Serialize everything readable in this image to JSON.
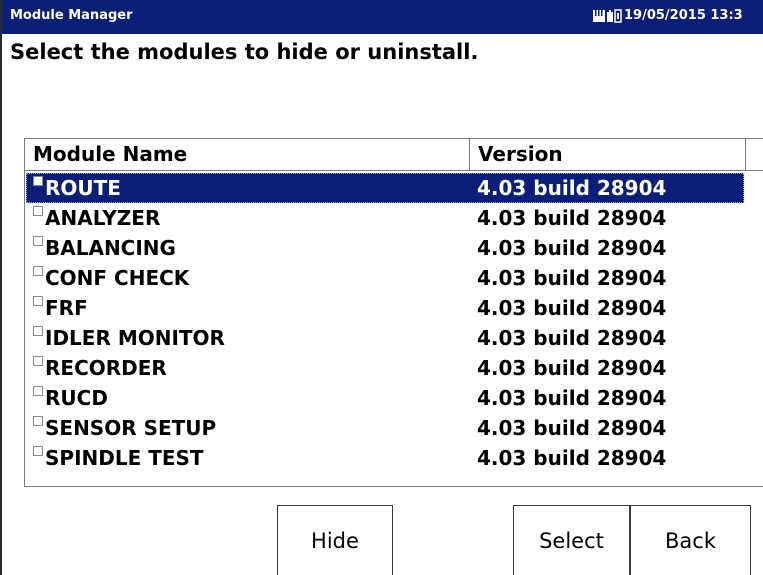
{
  "window": {
    "title": "Module Manager",
    "datetime": "19/05/2015 13:3",
    "status_icons": [
      "sd-card-icon",
      "battery-plug-icon"
    ]
  },
  "instruction": "Select the modules to hide or uninstall.",
  "table": {
    "columns": [
      "Module Name",
      "Version"
    ],
    "selected_index": 0,
    "rows": [
      {
        "name": "ROUTE",
        "version": "4.03 build 28904",
        "checked": false
      },
      {
        "name": "ANALYZER",
        "version": "4.03 build 28904",
        "checked": false
      },
      {
        "name": "BALANCING",
        "version": "4.03 build 28904",
        "checked": false
      },
      {
        "name": "CONF CHECK",
        "version": "4.03 build 28904",
        "checked": false
      },
      {
        "name": "FRF",
        "version": "4.03 build 28904",
        "checked": false
      },
      {
        "name": "IDLER MONITOR",
        "version": "4.03 build 28904",
        "checked": false
      },
      {
        "name": "RECORDER",
        "version": "4.03 build 28904",
        "checked": false
      },
      {
        "name": "RUCD",
        "version": "4.03 build 28904",
        "checked": false
      },
      {
        "name": "SENSOR SETUP",
        "version": "4.03 build 28904",
        "checked": false
      },
      {
        "name": "SPINDLE TEST",
        "version": "4.03 build 28904",
        "checked": false
      }
    ]
  },
  "buttons": {
    "hide": "Hide",
    "select": "Select",
    "back": "Back"
  },
  "colors": {
    "titlebar": "#0c1f78",
    "selection": "#0c1f78"
  }
}
